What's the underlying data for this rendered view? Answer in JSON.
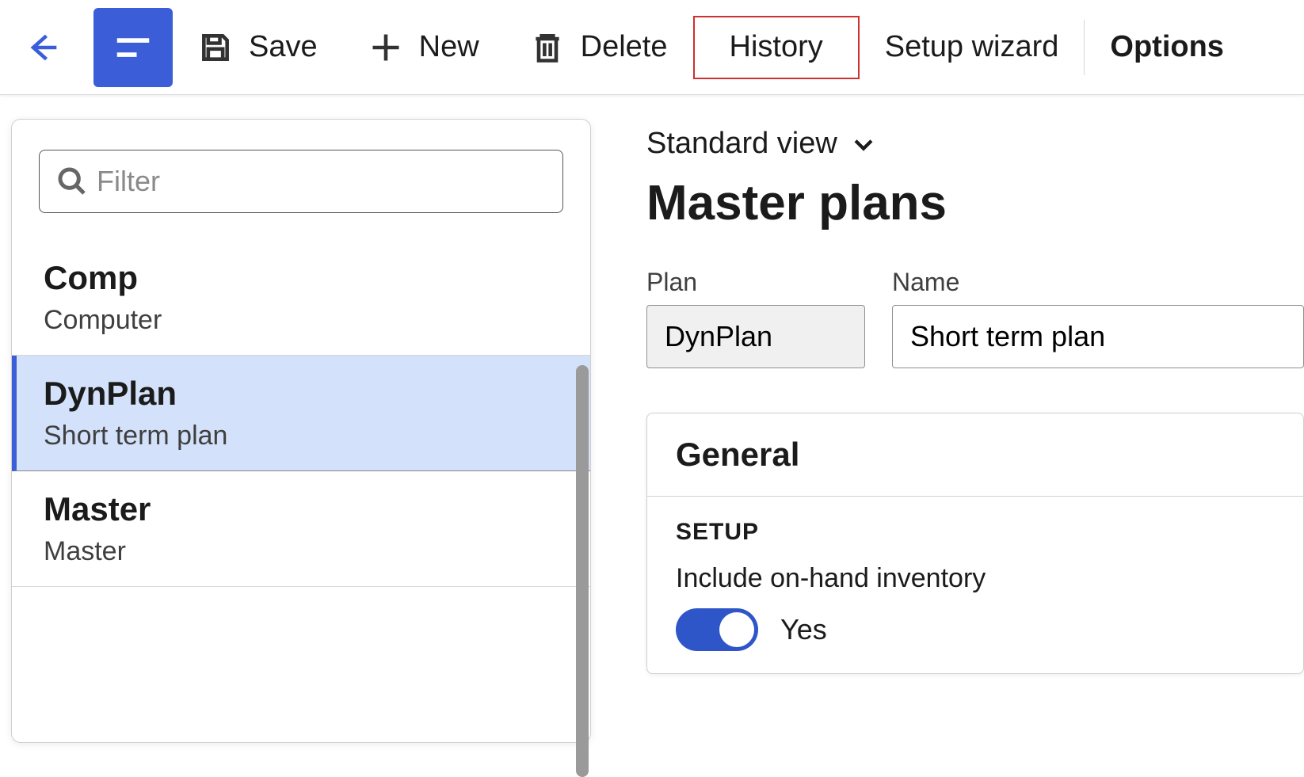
{
  "toolbar": {
    "save": "Save",
    "new": "New",
    "delete": "Delete",
    "history": "History",
    "setup_wizard": "Setup wizard",
    "options": "Options"
  },
  "filter": {
    "placeholder": "Filter"
  },
  "list": [
    {
      "code": "Comp",
      "name": "Computer",
      "selected": false
    },
    {
      "code": "DynPlan",
      "name": "Short term plan",
      "selected": true
    },
    {
      "code": "Master",
      "name": "Master",
      "selected": false
    }
  ],
  "detail": {
    "view_selector": "Standard view",
    "page_title": "Master plans",
    "fields": {
      "plan_label": "Plan",
      "plan_value": "DynPlan",
      "name_label": "Name",
      "name_value": "Short term plan"
    },
    "section": {
      "header": "General",
      "sub_heading": "SETUP",
      "toggle_label": "Include on-hand inventory",
      "toggle_state": "Yes"
    }
  }
}
